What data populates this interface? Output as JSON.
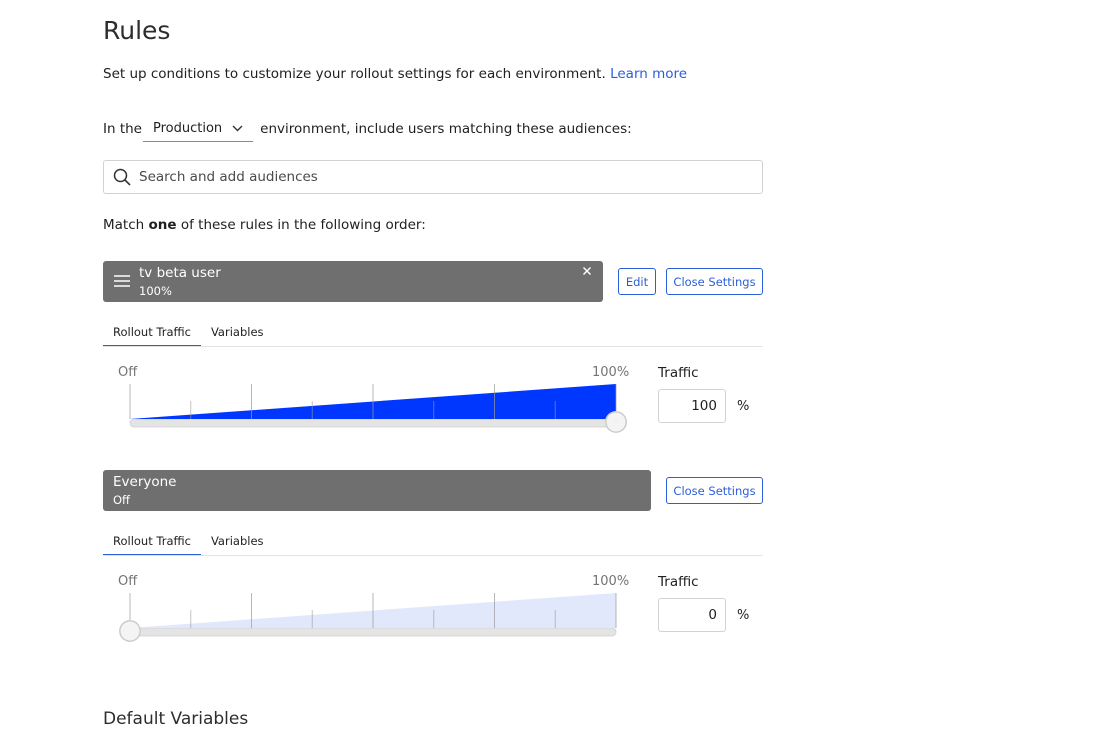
{
  "page": {
    "title": "Rules",
    "description": "Set up conditions to customize your rollout settings for each environment.",
    "learn_more": "Learn more",
    "env_prefix": "In the",
    "env_selected": "Production",
    "env_suffix": "environment, include users matching these audiences:",
    "search_placeholder": "Search and add audiences",
    "match_prefix": "Match",
    "match_bold": "one",
    "match_suffix": "of these rules in the following order:",
    "default_variables_heading": "Default Variables"
  },
  "rules": [
    {
      "name": "tv beta user",
      "summary": "100%",
      "edit_label": "Edit",
      "close_label": "Close Settings",
      "tabs": [
        "Rollout Traffic",
        "Variables"
      ],
      "slider_min_label": "Off",
      "slider_max_label": "100%",
      "traffic_label": "Traffic",
      "traffic_value": "100",
      "traffic_unit": "%",
      "traffic_fraction": 1.0,
      "fill_color": "#0037ff"
    },
    {
      "name": "Everyone",
      "summary": "Off",
      "close_label": "Close Settings",
      "tabs": [
        "Rollout Traffic",
        "Variables"
      ],
      "slider_min_label": "Off",
      "slider_max_label": "100%",
      "traffic_label": "Traffic",
      "traffic_value": "0",
      "traffic_unit": "%",
      "traffic_fraction": 0.0,
      "fill_color": "#e1e8fb"
    }
  ],
  "colors": {
    "accent": "#2b5fd9",
    "rule_bar": "#6f6f6f"
  }
}
